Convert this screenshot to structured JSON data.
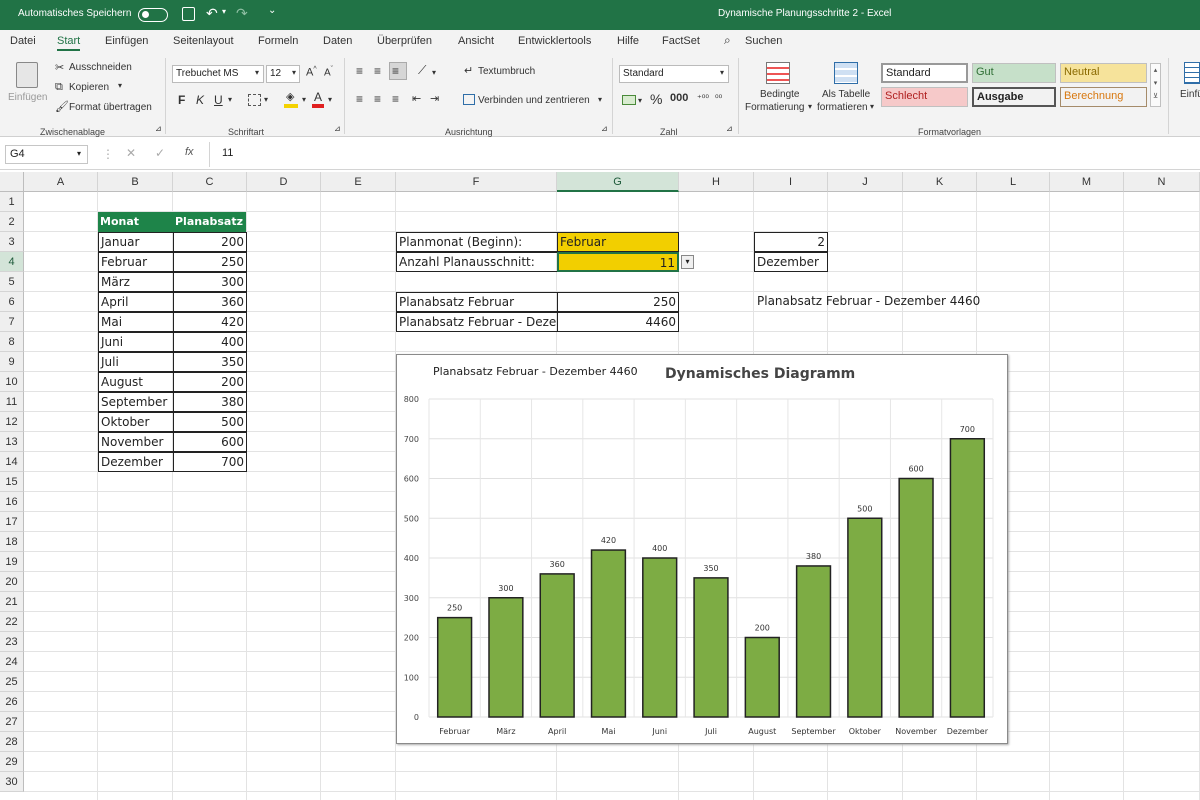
{
  "titlebar": {
    "autosave_label": "Automatisches Speichern",
    "doc_title": "Dynamische Planungsschritte 2  -  Excel"
  },
  "menu": [
    "Datei",
    "Start",
    "Einfügen",
    "Seitenlayout",
    "Formeln",
    "Daten",
    "Überprüfen",
    "Ansicht",
    "Entwicklertools",
    "Hilfe",
    "FactSet",
    "Suchen"
  ],
  "ribbon": {
    "clipboard": {
      "paste": "Einfügen",
      "cut": "Ausschneiden",
      "copy": "Kopieren",
      "format_painter": "Format übertragen",
      "group": "Zwischenablage"
    },
    "font": {
      "name": "Trebuchet MS",
      "size": "12",
      "bold": "F",
      "italic": "K",
      "underline": "U",
      "group": "Schriftart"
    },
    "alignment": {
      "wrap": "Textumbruch",
      "merge": "Verbinden und zentrieren",
      "group": "Ausrichtung"
    },
    "number": {
      "format": "Standard",
      "percent": "%",
      "group": "Zahl"
    },
    "styles": {
      "conditional": [
        "Bedingte",
        "Formatierung"
      ],
      "as_table": [
        "Als Tabelle",
        "formatieren"
      ],
      "cells": [
        "Standard",
        "Gut",
        "Neutral",
        "Schlecht",
        "Ausgabe",
        "Berechnung"
      ],
      "group": "Formatvorlagen"
    },
    "insert_cut": "Einfü"
  },
  "formula_bar": {
    "name_box": "G4",
    "fx": "fx",
    "value": "11"
  },
  "columns": [
    "A",
    "B",
    "C",
    "D",
    "E",
    "F",
    "G",
    "H",
    "I",
    "J",
    "K",
    "L",
    "M",
    "N"
  ],
  "rows": [
    "1",
    "2",
    "3",
    "4",
    "5",
    "6",
    "7",
    "8",
    "9",
    "10",
    "11",
    "12",
    "13",
    "14",
    "15",
    "16",
    "17",
    "18",
    "19",
    "20",
    "21",
    "22",
    "23",
    "24",
    "25",
    "26",
    "27",
    "28",
    "29",
    "30"
  ],
  "table": {
    "headers": [
      "Monat",
      "Planabsatz"
    ],
    "months": [
      "Januar",
      "Februar",
      "März",
      "April",
      "Mai",
      "Juni",
      "Juli",
      "August",
      "September",
      "Oktober",
      "November",
      "Dezember"
    ],
    "values": [
      "200",
      "250",
      "300",
      "360",
      "420",
      "400",
      "350",
      "200",
      "380",
      "500",
      "600",
      "700"
    ]
  },
  "inputs": {
    "planmonat_label": "Planmonat (Beginn):",
    "planmonat_value": "Februar",
    "anzahl_label": "Anzahl Planausschnitt:",
    "anzahl_value": "11",
    "i3": "2",
    "i4": "Dezember",
    "planabsatz_label": "Planabsatz Februar",
    "planabsatz_value": "250",
    "planabsatz_range_label": "Planabsatz Februar - Dezember",
    "planabsatz_range_value": "4460",
    "summary_text": "Planabsatz Februar - Dezember 4460"
  },
  "colors": {
    "excel_green": "#217346",
    "header_fill": "#1e8449",
    "input_fill": "#f2cf00",
    "bar": "#7dac44",
    "bar_stroke": "#222222"
  },
  "chart_data": {
    "type": "bar",
    "title": "Dynamisches Diagramm",
    "subtitle": "Planabsatz Februar - Dezember 4460",
    "categories": [
      "Februar",
      "März",
      "April",
      "Mai",
      "Juni",
      "Juli",
      "August",
      "September",
      "Oktober",
      "November",
      "Dezember"
    ],
    "values": [
      250,
      300,
      360,
      420,
      400,
      350,
      200,
      380,
      500,
      600,
      700
    ],
    "ylim": [
      0,
      800
    ],
    "yticks": [
      0,
      100,
      200,
      300,
      400,
      500,
      600,
      700,
      800
    ],
    "xlabel": "",
    "ylabel": "",
    "grid": true,
    "legend": "none",
    "data_labels": true
  }
}
